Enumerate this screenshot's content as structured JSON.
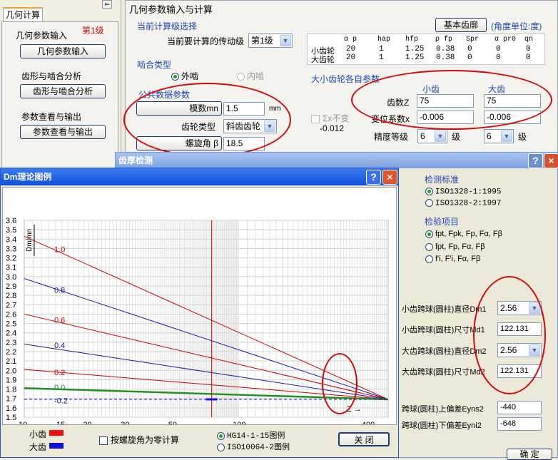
{
  "left_panel": {
    "tab": "几何计算",
    "level_badge": "第1级",
    "sections": [
      {
        "title": "几何参数输入",
        "button": "几何参数输入"
      },
      {
        "title": "齿形与啮合分析",
        "button": "齿形与啮合分析"
      },
      {
        "title": "参数查看与输出",
        "button": "参数查看与输出"
      }
    ]
  },
  "main": {
    "title": "几何参数输入与计算",
    "stage_group": "当前计算级选择",
    "stage_label": "当前要计算的传动级",
    "stage_value": "第1级",
    "basic_rack_button": "基本齿廓",
    "angle_unit": "(角度单位:度)",
    "rack_table": {
      "headers": [
        "α p",
        "hap",
        "hfp",
        "ρ fp",
        "Spr",
        "α pr0",
        "qn"
      ],
      "rows": [
        {
          "name": "小齿轮",
          "values": [
            "20",
            "1",
            "1.25",
            "0.38",
            "0",
            "0",
            "0"
          ]
        },
        {
          "name": "大齿轮",
          "values": [
            "20",
            "1",
            "1.25",
            "0.38",
            "0",
            "0",
            "0"
          ]
        }
      ]
    },
    "mesh_group": "啮合类型",
    "mesh_external": "外啮",
    "mesh_internal": "内啮",
    "common_group": "公共数据参数",
    "module_button": "模数mn",
    "module_value": "1.5",
    "module_unit": "mm",
    "gear_type_label": "齿轮类型",
    "gear_type_value": "斜齿齿轮",
    "helix_button": "螺旋角 β",
    "helix_value": "18.5",
    "gear_params_group": "大小齿轮各自参数",
    "small_gear": "小齿",
    "big_gear": "大齿",
    "teeth_label": "齿数Z",
    "teeth_small": "75",
    "teeth_big": "75",
    "shift_label": "变位系数x",
    "shift_small": "-0.006",
    "shift_big": "-0.006",
    "accuracy_label": "精度等级",
    "accuracy_small": "6",
    "accuracy_big": "6",
    "accuracy_unit": "级",
    "sum_x_label": "Σx不变",
    "sum_x_value": "-0.012"
  },
  "tooth_dialog": {
    "title": "齿厚检测",
    "standard_group": "检测标准",
    "standards": [
      "ISO1328-1:1995",
      "ISO1328-2:1997"
    ],
    "items_group": "检验项目",
    "items": [
      "fpt, Fpk, Fp, Fα, Fβ",
      "fpt, Fp, Fα, Fβ",
      "f'i, F'i, Fα, Fβ"
    ],
    "rows": [
      {
        "label": "小齿跨球(圆柱)直径Dm1",
        "value": "2.56",
        "type": "select"
      },
      {
        "label": "小齿跨球(圆柱)尺寸Md1",
        "value": "122.131",
        "type": "input"
      },
      {
        "label": "大齿跨球(圆柱)直径Dm2",
        "value": "2.56",
        "type": "select"
      },
      {
        "label": "大齿跨球(圆柱)尺寸Md2",
        "value": "122.131",
        "type": "input"
      }
    ],
    "upper_dev_label": "跨球(圆柱)上偏差Eyns2",
    "upper_dev_value": "-440",
    "lower_dev_label": "跨球(圆柱)下偏差Eyni2",
    "lower_dev_value": "-648",
    "ok_button": "确  定"
  },
  "dm_dialog": {
    "title": "Dm理论图例",
    "help": "?",
    "close": "×",
    "small_gear_legend": "小齿",
    "big_gear_legend": "大齿",
    "zero_helix_checkbox": "按螺旋角为零计算",
    "radio_hg": "HG14-1-15图例",
    "radio_iso": "ISO10064-2图例",
    "close_button": "关  闭"
  },
  "chart_data": {
    "type": "line",
    "ylabel": "Dm/mn",
    "xlabel": "Z",
    "x_scale": "log",
    "y_ticks": [
      "3.6",
      "3.5",
      "3.4",
      "3.3",
      "3.2",
      "3.1",
      "3.0",
      "2.9",
      "2.8",
      "2.7",
      "2.6",
      "2.5",
      "2.4",
      "2.3",
      "2.2",
      "2.1",
      "2.0",
      "1.9",
      "1.8",
      "1.7",
      "1.6",
      "1.5"
    ],
    "x_ticks": [
      {
        "z": 10,
        "label": "10"
      },
      {
        "z": 15,
        "label": "15"
      },
      {
        "z": 20,
        "label": "20"
      },
      {
        "z": 30,
        "label": "30"
      },
      {
        "z": 50,
        "label": "50"
      },
      {
        "z": 100,
        "label": "100"
      },
      {
        "z": 200,
        "label": "200"
      },
      {
        "z": 400,
        "label": "400"
      },
      {
        "z": 500,
        "label": "∞"
      }
    ],
    "ylim": [
      1.5,
      3.6
    ],
    "xlim": [
      10,
      500
    ],
    "current_z": 75,
    "series": [
      {
        "name": "1.0",
        "color": "#cc0000",
        "y_start": 3.43,
        "label_y": 3.29
      },
      {
        "name": "0.8",
        "color": "#1a1aa8",
        "y_start": 2.98,
        "label_y": 2.86
      },
      {
        "name": "0.6",
        "color": "#cc0000",
        "y_start": 2.6,
        "label_y": 2.54
      },
      {
        "name": "0.4",
        "color": "#1a1aa8",
        "y_start": 2.28,
        "label_y": 2.27
      },
      {
        "name": "0.2",
        "color": "#cc0000",
        "y_start": 2.01,
        "label_y": 1.98
      },
      {
        "name": "0.0",
        "color": "#1f8f1f",
        "y_start": 1.81,
        "label_y": 1.82
      },
      {
        "name": "-0.2",
        "color": "#1a1aa8",
        "y_start": 1.69,
        "label_y": 1.68
      }
    ],
    "converge_y": 1.69
  }
}
